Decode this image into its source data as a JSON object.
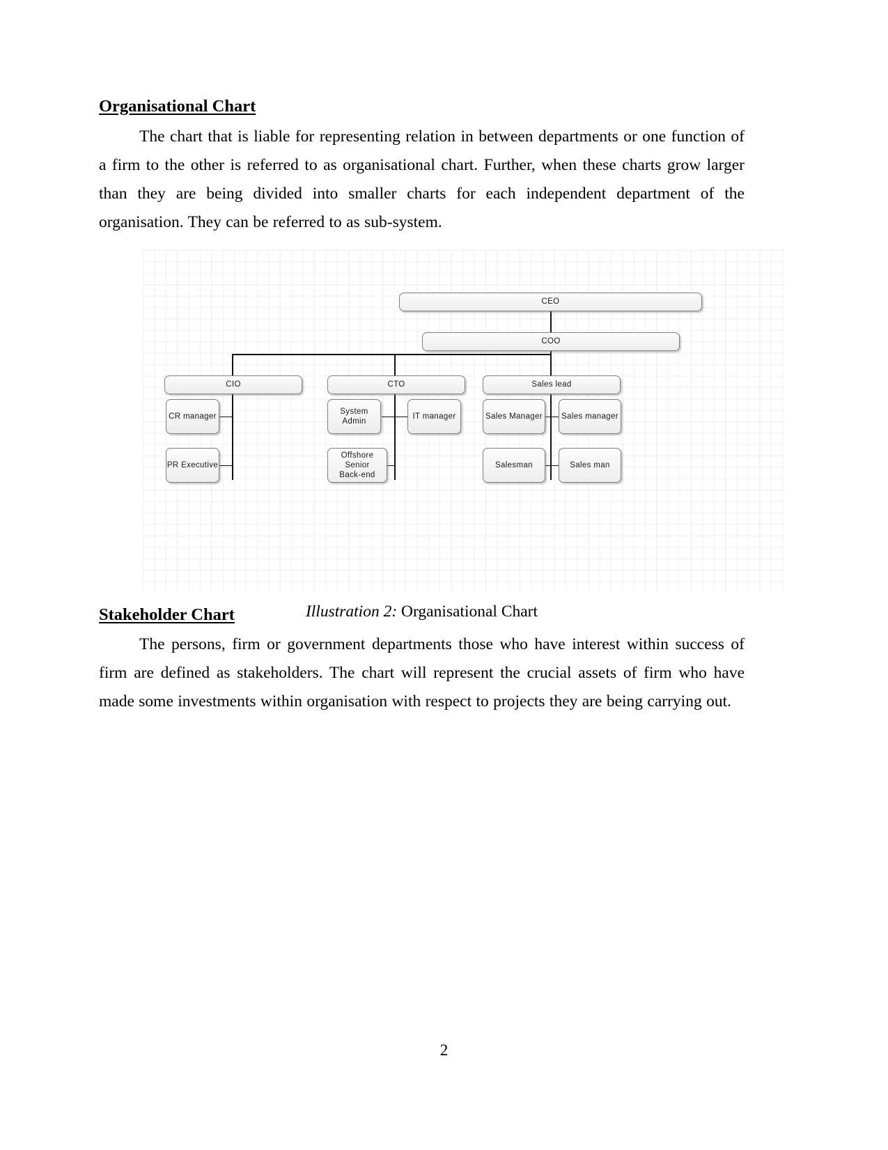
{
  "document": {
    "page_number": "2"
  },
  "sections": [
    {
      "heading": "Organisational Chart ",
      "paragraph": "The chart that is liable for representing relation in between departments or one function of a firm to the other is referred to as organisational chart. Further, when these charts grow larger than they are being divided into smaller charts for each independent department of the organisation. They can be referred to as sub-system."
    },
    {
      "heading": "Stakeholder Chart",
      "paragraph": "The persons, firm or government departments those who have interest within success of firm are defined as stakeholders. The chart will represent the crucial assets of firm who have made some investments within organisation with respect to projects they are being carrying out."
    }
  ],
  "figure": {
    "caption_label": "Illustration 2:",
    "caption_text": " Organisational Chart"
  },
  "chart_data": {
    "type": "diagram",
    "diagram_kind": "organisational-chart",
    "title": "Organisational Chart",
    "nodes": [
      {
        "id": "ceo",
        "label": "CEO",
        "level": 0
      },
      {
        "id": "coo",
        "label": "COO",
        "level": 1
      },
      {
        "id": "cio",
        "label": "CIO",
        "level": 2
      },
      {
        "id": "cto",
        "label": "CTO",
        "level": 2
      },
      {
        "id": "sales_lead",
        "label": "Sales lead",
        "level": 2
      },
      {
        "id": "cr_manager",
        "label": "CR manager",
        "level": 3
      },
      {
        "id": "pr_executive",
        "label": "PR Executive",
        "level": 3
      },
      {
        "id": "system_admin",
        "label": "System\nAdmin",
        "level": 3
      },
      {
        "id": "it_manager",
        "label": "IT manager",
        "level": 3
      },
      {
        "id": "offshore_be",
        "label": "Offshore Senior\nBack-end",
        "level": 3
      },
      {
        "id": "sales_manager1",
        "label": "Sales Manager",
        "level": 3
      },
      {
        "id": "sales_manager2",
        "label": "Sales manager",
        "level": 3
      },
      {
        "id": "salesman",
        "label": "Salesman",
        "level": 3
      },
      {
        "id": "sales_man",
        "label": "Sales man",
        "level": 3
      }
    ],
    "edges": [
      {
        "from": "ceo",
        "to": "coo"
      },
      {
        "from": "coo",
        "to": "cio"
      },
      {
        "from": "coo",
        "to": "cto"
      },
      {
        "from": "coo",
        "to": "sales_lead"
      },
      {
        "from": "cio",
        "to": "cr_manager"
      },
      {
        "from": "cio",
        "to": "pr_executive"
      },
      {
        "from": "cto",
        "to": "system_admin"
      },
      {
        "from": "cto",
        "to": "it_manager"
      },
      {
        "from": "cto",
        "to": "offshore_be"
      },
      {
        "from": "sales_lead",
        "to": "sales_manager1"
      },
      {
        "from": "sales_lead",
        "to": "sales_manager2"
      },
      {
        "from": "sales_lead",
        "to": "salesman"
      },
      {
        "from": "sales_lead",
        "to": "sales_man"
      }
    ],
    "style": {
      "background": "#ffffff",
      "grid_minor": "#f1f1f1",
      "grid_major": "#e2e2e2",
      "node_fill": "#f4f4f4",
      "node_border": "#7f7f7f",
      "edge_color": "#111111"
    }
  },
  "node_labels": {
    "ceo": "CEO",
    "coo": "COO",
    "cio": "CIO",
    "cto": "CTO",
    "sales_lead": "Sales lead",
    "cr_manager": "CR manager",
    "pr_executive": "PR Executive",
    "system_admin_l1": "System",
    "system_admin_l2": "Admin",
    "it_manager": "IT manager",
    "offshore_l1": "Offshore Senior",
    "offshore_l2": "Back-end",
    "sales_manager1": "Sales Manager",
    "sales_manager2": "Sales manager",
    "salesman": "Salesman",
    "sales_man": "Sales man"
  }
}
